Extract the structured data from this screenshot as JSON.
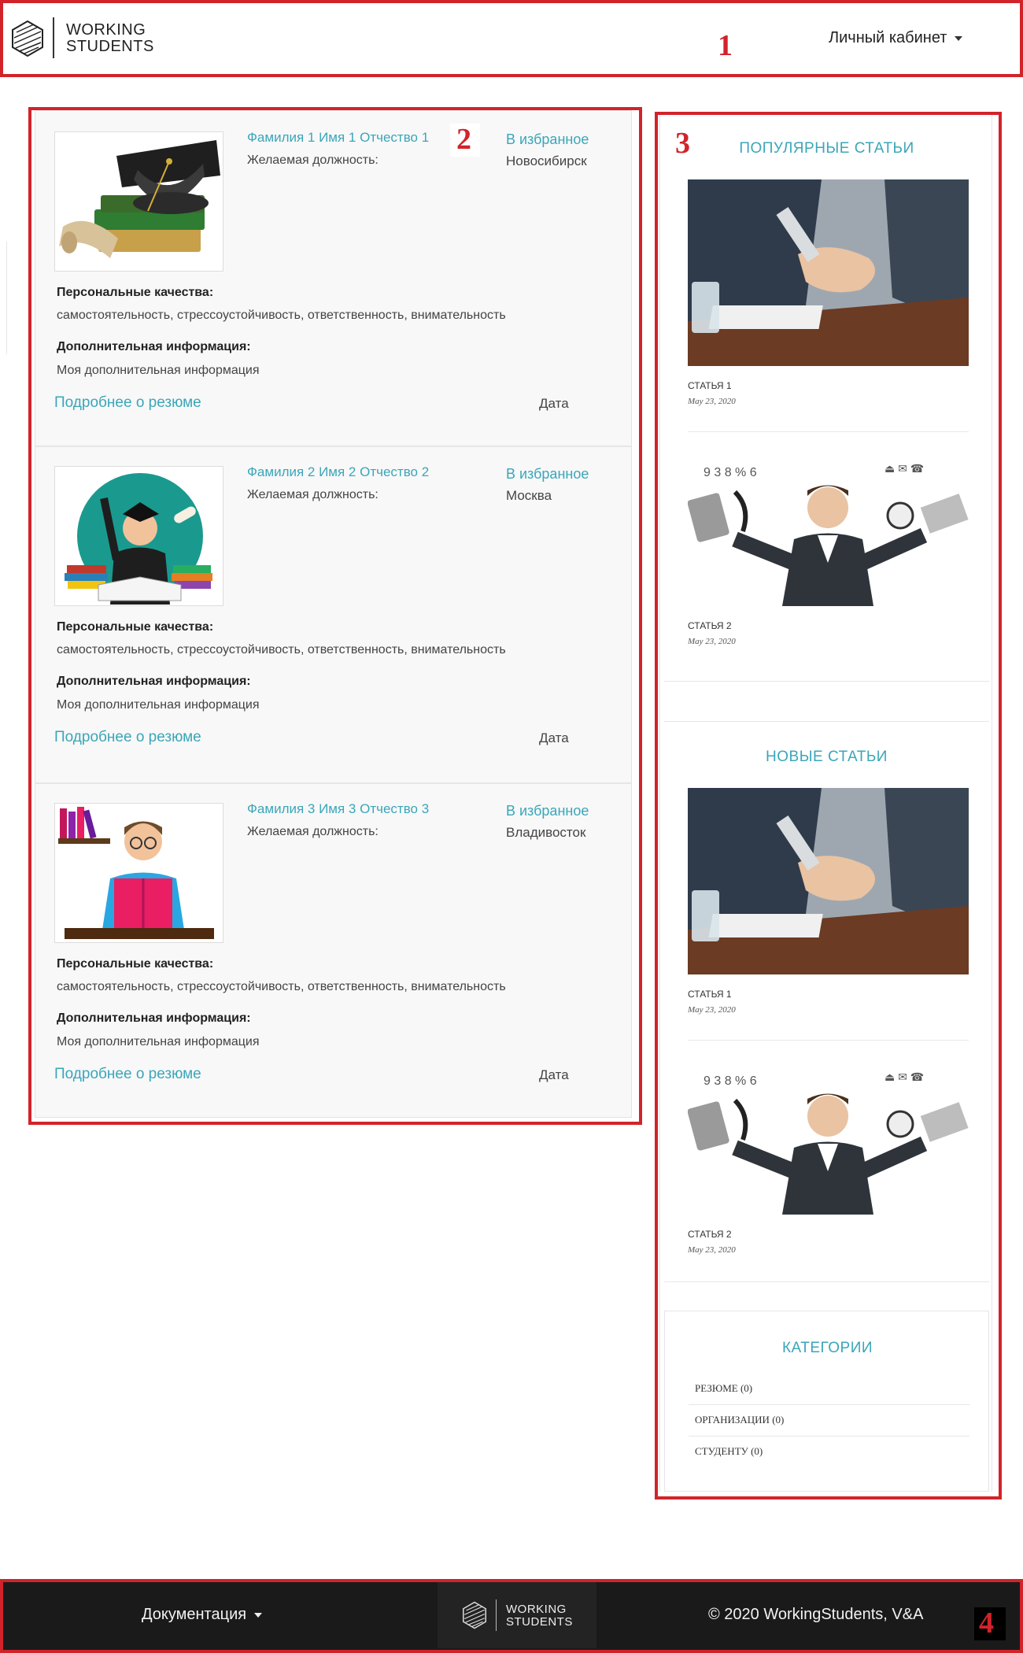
{
  "header": {
    "logo_line1": "WORKING",
    "logo_line2": "STUDENTS",
    "cabinet_label": "Личный кабинет"
  },
  "annotations": [
    "1",
    "2",
    "3",
    "4"
  ],
  "resumes": [
    {
      "name": "Фамилия 1 Имя 1 Отчество 1",
      "favorite": "В избранное",
      "position_label": "Желаемая должность:",
      "city": "Новосибирск",
      "image": "graduation-cap-books-icon",
      "qualities_label": "Персональные качества:",
      "qualities": "самостоятельность, стрессоустойчивость, ответственность, внимательность",
      "extra_label": "Дополнительная информация:",
      "extra": "Моя дополнительная информация",
      "more": "Подробнее о резюме",
      "date": "Дата"
    },
    {
      "name": "Фамилия 2 Имя 2 Отчество 2",
      "favorite": "В избранное",
      "position_label": "Желаемая должность:",
      "city": "Москва",
      "image": "graduate-student-icon",
      "qualities_label": "Персональные качества:",
      "qualities": "самостоятельность, стрессоустойчивость, ответственность, внимательность",
      "extra_label": "Дополнительная информация:",
      "extra": "Моя дополнительная информация",
      "more": "Подробнее о резюме",
      "date": "Дата"
    },
    {
      "name": "Фамилия 3 Имя 3 Отчество 3",
      "favorite": "В избранное",
      "position_label": "Желаемая должность:",
      "city": "Владивосток",
      "image": "reading-student-icon",
      "qualities_label": "Персональные качества:",
      "qualities": "самостоятельность, стрессоустойчивость, ответственность, внимательность",
      "extra_label": "Дополнительная информация:",
      "extra": "Моя дополнительная информация",
      "more": "Подробнее о резюме",
      "date": "Дата"
    }
  ],
  "sidebar": {
    "popular_title": "ПОПУЛЯРНЫЕ СТАТЬИ",
    "popular": [
      {
        "title": "СТАТЬЯ 1",
        "date": "May 23, 2020",
        "image": "handshake-photo"
      },
      {
        "title": "СТАТЬЯ 2",
        "date": "May 23, 2020",
        "image": "multitasking-man-photo"
      }
    ],
    "new_title": "НОВЫЕ СТАТЬИ",
    "new": [
      {
        "title": "СТАТЬЯ 1",
        "date": "May 23, 2020",
        "image": "handshake-photo"
      },
      {
        "title": "СТАТЬЯ 2",
        "date": "May 23, 2020",
        "image": "multitasking-man-photo"
      }
    ],
    "categories_title": "КАТЕГОРИИ",
    "categories": [
      {
        "label": "РЕЗЮМЕ",
        "count": "(0)"
      },
      {
        "label": "ОРГАНИЗАЦИИ",
        "count": "(0)"
      },
      {
        "label": "СТУДЕНТУ",
        "count": "(0)"
      }
    ]
  },
  "footer": {
    "docs_label": "Документация",
    "logo_line1": "WORKING",
    "logo_line2": "STUDENTS",
    "copyright": "© 2020 WorkingStudents, V&A"
  },
  "colors": {
    "accent": "#3aa6b9",
    "annotation_red": "#d2232a",
    "footer_bg": "#1a1a1a"
  }
}
